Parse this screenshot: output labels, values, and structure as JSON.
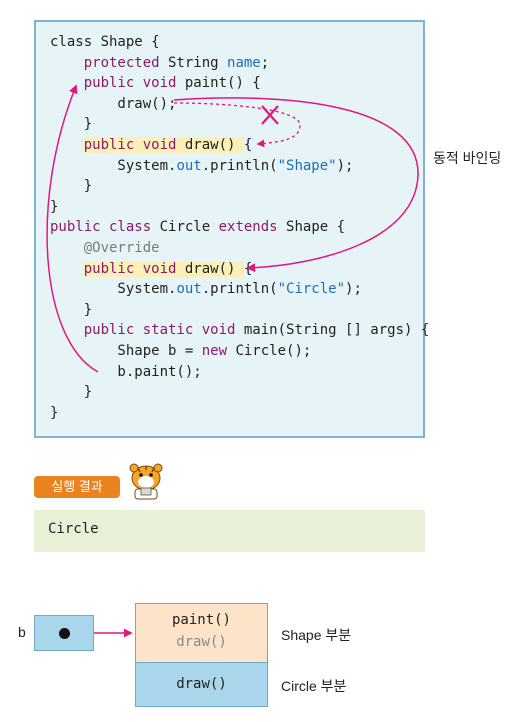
{
  "code_lines": [
    [
      {
        "t": "class Shape {"
      }
    ],
    [
      {
        "t": "    "
      },
      {
        "t": "protected",
        "c": "kw"
      },
      {
        "t": " String "
      },
      {
        "t": "name",
        "c": "fld"
      },
      {
        "t": ";"
      }
    ],
    [
      {
        "t": "    "
      },
      {
        "t": "public void",
        "c": "kw"
      },
      {
        "t": " paint() {"
      }
    ],
    [
      {
        "t": "        draw();"
      }
    ],
    [
      {
        "t": "    }"
      }
    ],
    [
      {
        "t": "    "
      },
      {
        "t": "public void",
        "c": "kw hl"
      },
      {
        "t": " draw() ",
        "c": "hl"
      },
      {
        "t": "{"
      }
    ],
    [
      {
        "t": "        System."
      },
      {
        "t": "out",
        "c": "fld"
      },
      {
        "t": ".println("
      },
      {
        "t": "\"Shape\"",
        "c": "str"
      },
      {
        "t": ");"
      }
    ],
    [
      {
        "t": "    }"
      }
    ],
    [
      {
        "t": "}"
      }
    ],
    [
      {
        "t": "public class",
        "c": "kw"
      },
      {
        "t": " Circle "
      },
      {
        "t": "extends",
        "c": "kw"
      },
      {
        "t": " Shape {"
      }
    ],
    [
      {
        "t": "    "
      },
      {
        "t": "@Override",
        "c": "ann"
      }
    ],
    [
      {
        "t": "    "
      },
      {
        "t": "public void",
        "c": "kw hl"
      },
      {
        "t": " draw() ",
        "c": "hl"
      },
      {
        "t": "{"
      }
    ],
    [
      {
        "t": "        System."
      },
      {
        "t": "out",
        "c": "fld"
      },
      {
        "t": ".println("
      },
      {
        "t": "\"Circle\"",
        "c": "str"
      },
      {
        "t": ");"
      }
    ],
    [
      {
        "t": "    }"
      }
    ],
    [
      {
        "t": "    "
      },
      {
        "t": "public static void",
        "c": "kw"
      },
      {
        "t": " main(String [] args) {"
      }
    ],
    [
      {
        "t": "        Shape b = "
      },
      {
        "t": "new",
        "c": "kw"
      },
      {
        "t": " Circle();"
      }
    ],
    [
      {
        "t": "        b.paint();"
      }
    ],
    [
      {
        "t": "    }"
      }
    ],
    [
      {
        "t": "}"
      }
    ]
  ],
  "side_label": "동적 바인딩",
  "result_badge": "실행 결과",
  "output": "Circle",
  "diagram": {
    "ref_label": "b",
    "shape_methods": [
      "paint()",
      "draw()"
    ],
    "circle_method": "draw()",
    "shape_part_label": "Shape 부분",
    "circle_part_label": "Circle 부분"
  },
  "colors": {
    "arrow": "#e0197d",
    "keyword": "#8a1a6a",
    "field": "#1f6db5",
    "highlight": "#fbf0b8",
    "badge": "#e9821f"
  }
}
